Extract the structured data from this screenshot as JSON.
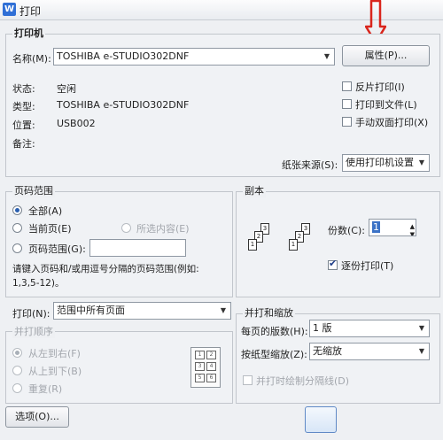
{
  "window": {
    "title": "打印",
    "logo": "W"
  },
  "printer": {
    "group_label": "打印机",
    "name_label": "名称(M):",
    "name_value": "TOSHIBA e-STUDIO302DNF",
    "properties_button": "属性(P)...",
    "status_label": "状态:",
    "status_value": "空闲",
    "type_label": "类型:",
    "type_value": "TOSHIBA e-STUDIO302DNF",
    "where_label": "位置:",
    "where_value": "USB002",
    "comment_label": "备注:",
    "reverse_print": "反片打印(I)",
    "print_to_file": "打印到文件(L)",
    "manual_duplex": "手动双面打印(X)",
    "paper_source_label": "纸张来源(S):",
    "paper_source_value": "使用打印机设置"
  },
  "page_range": {
    "group_label": "页码范围",
    "all": "全部(A)",
    "current": "当前页(E)",
    "selection": "所选内容(E)",
    "pages": "页码范围(G):",
    "hint_line1": "请键入页码和/或用逗号分隔的页码范围(例如:",
    "hint_line2": "1,3,5-12)。"
  },
  "copies": {
    "group_label": "副本",
    "count_label": "份数(C):",
    "count_value": "1",
    "collate": "逐份打印(T)"
  },
  "print_what": {
    "label": "打印(N):",
    "value": "范围中所有页面",
    "order_label": "并打顺序",
    "left_to_right": "从左到右(F)",
    "top_to_bottom": "从上到下(B)",
    "repeat": "重复(R)"
  },
  "zoom": {
    "group_label": "并打和缩放",
    "pages_per_sheet_label": "每页的版数(H):",
    "pages_per_sheet_value": "1 版",
    "scale_label": "按纸型缩放(Z):",
    "scale_value": "无缩放",
    "draw_borders": "并打时绘制分隔线(D)"
  },
  "footer": {
    "options_button": "选项(O)..."
  },
  "annotation": {
    "color": "#d9251c"
  }
}
